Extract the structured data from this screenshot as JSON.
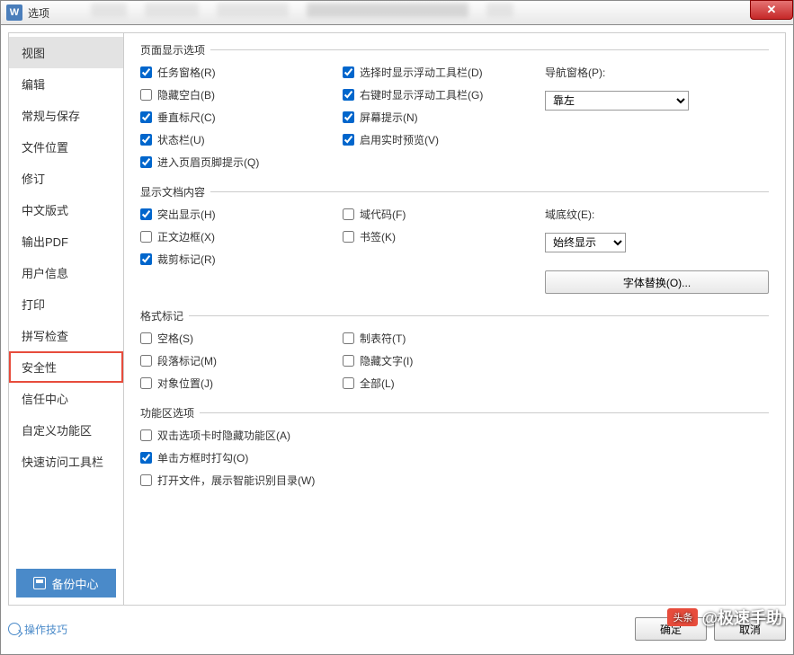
{
  "window": {
    "title": "选项",
    "app_icon_text": "W"
  },
  "sidebar": {
    "items": [
      {
        "label": "视图",
        "selected": true
      },
      {
        "label": "编辑"
      },
      {
        "label": "常规与保存"
      },
      {
        "label": "文件位置"
      },
      {
        "label": "修订"
      },
      {
        "label": "中文版式"
      },
      {
        "label": "输出PDF"
      },
      {
        "label": "用户信息"
      },
      {
        "label": "打印"
      },
      {
        "label": "拼写检查"
      },
      {
        "label": "安全性",
        "highlighted": true
      },
      {
        "label": "信任中心"
      },
      {
        "label": "自定义功能区"
      },
      {
        "label": "快速访问工具栏"
      }
    ],
    "backup_label": "备份中心"
  },
  "sections": {
    "page_display": {
      "legend": "页面显示选项",
      "col1": [
        {
          "label": "任务窗格(R)",
          "checked": true
        },
        {
          "label": "隐藏空白(B)",
          "checked": false
        },
        {
          "label": "垂直标尺(C)",
          "checked": true
        },
        {
          "label": "状态栏(U)",
          "checked": true
        },
        {
          "label": "进入页眉页脚提示(Q)",
          "checked": true
        }
      ],
      "col2": [
        {
          "label": "选择时显示浮动工具栏(D)",
          "checked": true
        },
        {
          "label": "右键时显示浮动工具栏(G)",
          "checked": true
        },
        {
          "label": "屏幕提示(N)",
          "checked": true
        },
        {
          "label": "启用实时预览(V)",
          "checked": true
        }
      ],
      "nav_pane": {
        "label": "导航窗格(P):",
        "value": "靠左"
      }
    },
    "doc_content": {
      "legend": "显示文档内容",
      "col1": [
        {
          "label": "突出显示(H)",
          "checked": true
        },
        {
          "label": "正文边框(X)",
          "checked": false
        },
        {
          "label": "裁剪标记(R)",
          "checked": true
        }
      ],
      "col2": [
        {
          "label": "域代码(F)",
          "checked": false
        },
        {
          "label": "书签(K)",
          "checked": false
        }
      ],
      "shading": {
        "label": "域底纹(E):",
        "value": "始终显示"
      },
      "font_sub_btn": "字体替换(O)..."
    },
    "format_marks": {
      "legend": "格式标记",
      "col1": [
        {
          "label": "空格(S)",
          "checked": false
        },
        {
          "label": "段落标记(M)",
          "checked": false
        },
        {
          "label": "对象位置(J)",
          "checked": false
        }
      ],
      "col2": [
        {
          "label": "制表符(T)",
          "checked": false
        },
        {
          "label": "隐藏文字(I)",
          "checked": false
        },
        {
          "label": "全部(L)",
          "checked": false
        }
      ]
    },
    "ribbon": {
      "legend": "功能区选项",
      "items": [
        {
          "label": "双击选项卡时隐藏功能区(A)",
          "checked": false
        },
        {
          "label": "单击方框时打勾(O)",
          "checked": true
        },
        {
          "label": "打开文件，展示智能识别目录(W)",
          "checked": false
        }
      ]
    }
  },
  "footer": {
    "tips_label": "操作技巧",
    "ok": "确定",
    "cancel": "取消"
  },
  "watermark": {
    "badge": "头条",
    "text": "@极速手助"
  }
}
